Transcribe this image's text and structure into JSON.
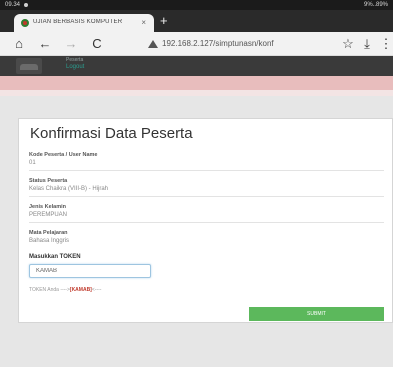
{
  "status_bar": {
    "time": "09.34",
    "right_text": "9%..89%"
  },
  "browser": {
    "tab_title": "UJIAN BERBASIS KOMPUTER",
    "tab_close": "×",
    "new_tab": "+",
    "url": "192.168.2.127/simptunasn/konf",
    "buttons": {
      "home": "⌂",
      "back": "←",
      "forward": "→",
      "reload": "C",
      "star": "☆",
      "download": "⤓",
      "menu": "⋮"
    }
  },
  "app_header": {
    "username": "Peserta",
    "logout_label": "Logout"
  },
  "card": {
    "title": "Konfirmasi Data Peserta",
    "fields": [
      {
        "label": "Kode Peserta / User Name",
        "value": "01"
      },
      {
        "label": "Status Peserta",
        "value": "Kelas Chaikra (VIII-B) - Hijrah"
      },
      {
        "label": "Jenis Kelamin",
        "value": "PEREMPUAN"
      },
      {
        "label": "Mata Pelajaran",
        "value": "Bahasa Inggris"
      }
    ],
    "token_label": "Masukkan TOKEN",
    "token_value": "KAMAB",
    "token_note_prefix": "TOKEN Anda ---->",
    "token_note_code": "[KAMAB]",
    "token_note_suffix": "<----",
    "submit_label": "SUBMIT"
  }
}
